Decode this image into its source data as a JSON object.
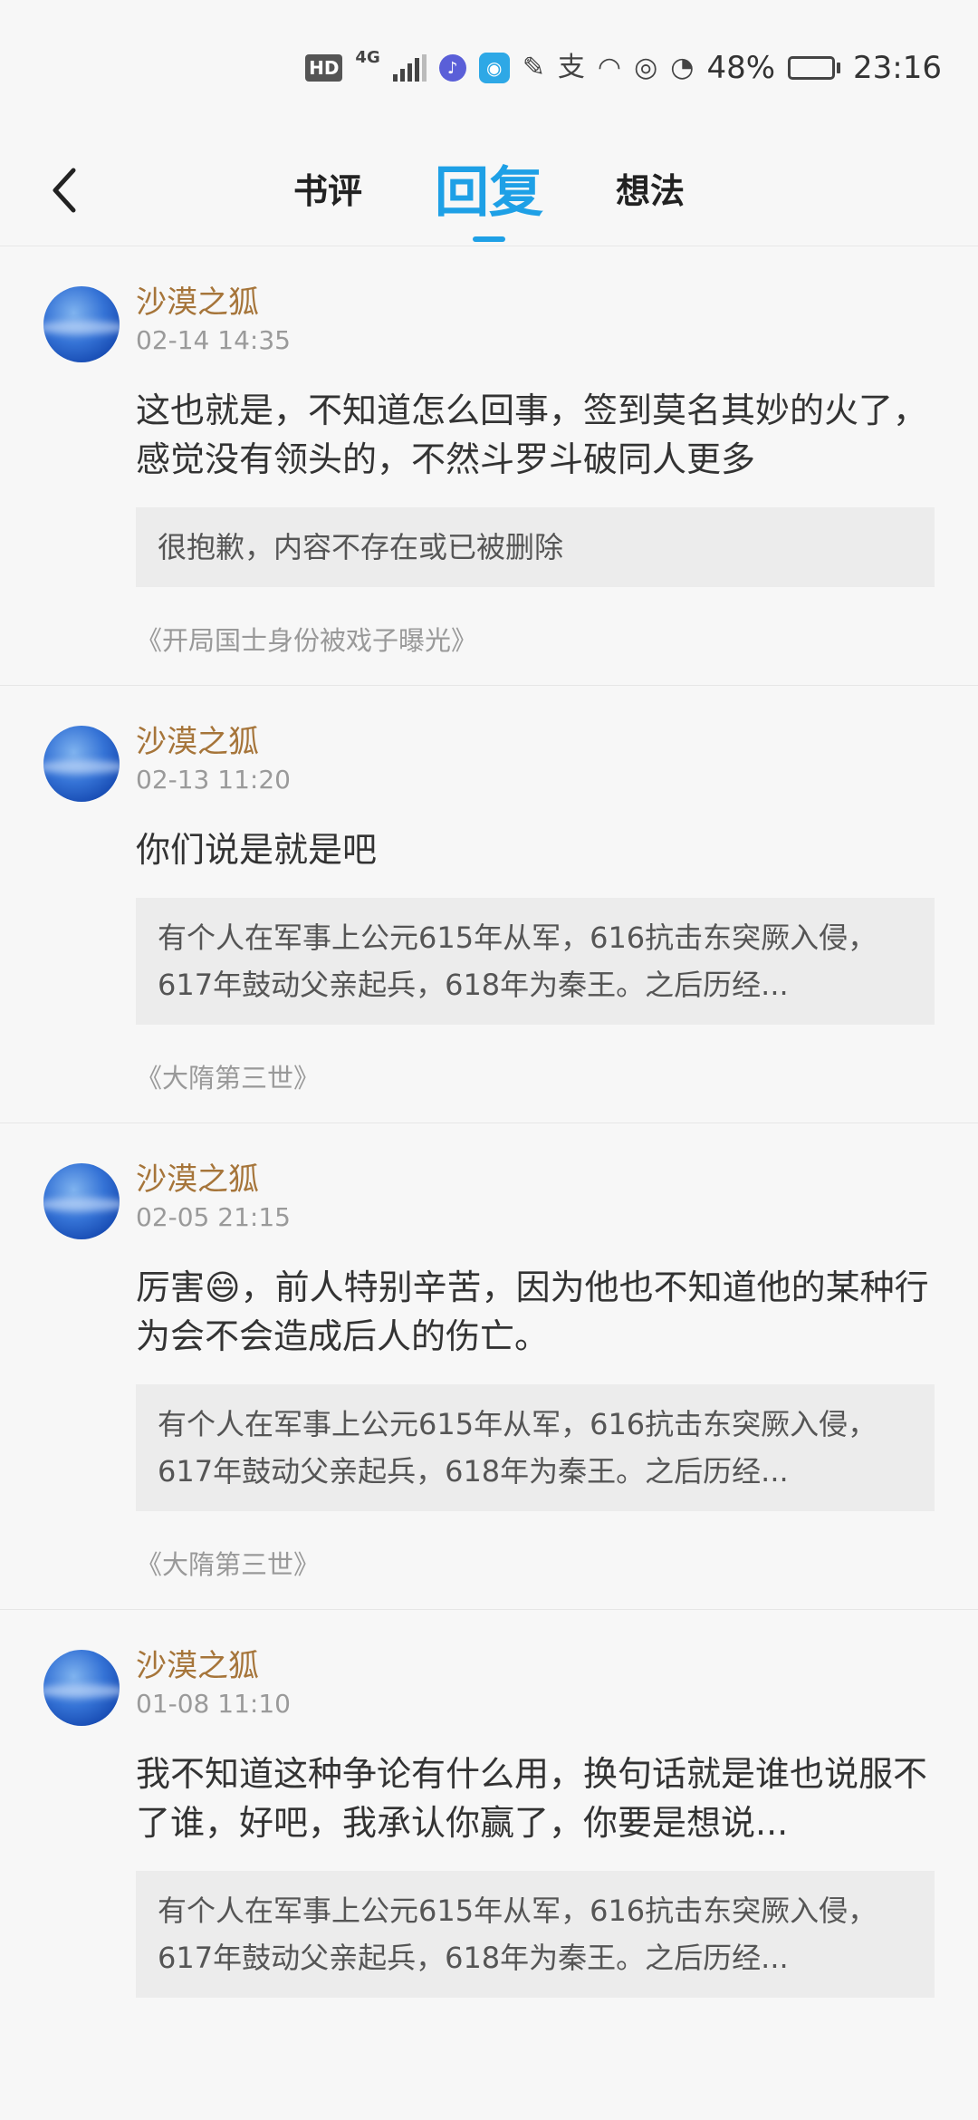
{
  "status_bar": {
    "network": "4G",
    "battery_percent": "48%",
    "battery_level": 0.48,
    "time": "23:16",
    "icons": [
      "hd-icon",
      "signal-icon",
      "music-icon",
      "bulb-icon",
      "study-icon",
      "alipay-icon",
      "headphone-icon",
      "eye-icon",
      "speedometer-icon",
      "battery-icon"
    ]
  },
  "nav": {
    "tabs": [
      {
        "label": "书评"
      },
      {
        "label": "回复"
      },
      {
        "label": "想法"
      }
    ],
    "active_tab": 1
  },
  "replies": [
    {
      "user": "沙漠之狐",
      "time": "02-14 14:35",
      "content": "这也就是，不知道怎么回事，签到莫名其妙的火了，感觉没有领头的，不然斗罗斗破同人更多",
      "quote": "很抱歉，内容不存在或已被删除",
      "book": "《开局国士身份被戏子曝光》"
    },
    {
      "user": "沙漠之狐",
      "time": "02-13 11:20",
      "content": "你们说是就是吧",
      "quote": "有个人在军事上公元615年从军，616抗击东突厥入侵，617年鼓动父亲起兵，618年为秦王。之后历经...",
      "book": "《大隋第三世》"
    },
    {
      "user": "沙漠之狐",
      "time": "02-05 21:15",
      "content": "厉害😄，前人特别辛苦，因为他也不知道他的某种行为会不会造成后人的伤亡。",
      "quote": "有个人在军事上公元615年从军，616抗击东突厥入侵，617年鼓动父亲起兵，618年为秦王。之后历经...",
      "book": "《大隋第三世》"
    },
    {
      "user": "沙漠之狐",
      "time": "01-08 11:10",
      "content": "我不知道这种争论有什么用，换句话就是谁也说服不了谁，好吧，我承认你赢了，你要是想说...",
      "quote": "有个人在军事上公元615年从军，616抗击东突厥入侵，617年鼓动父亲起兵，618年为秦王。之后历经...",
      "book": ""
    }
  ]
}
